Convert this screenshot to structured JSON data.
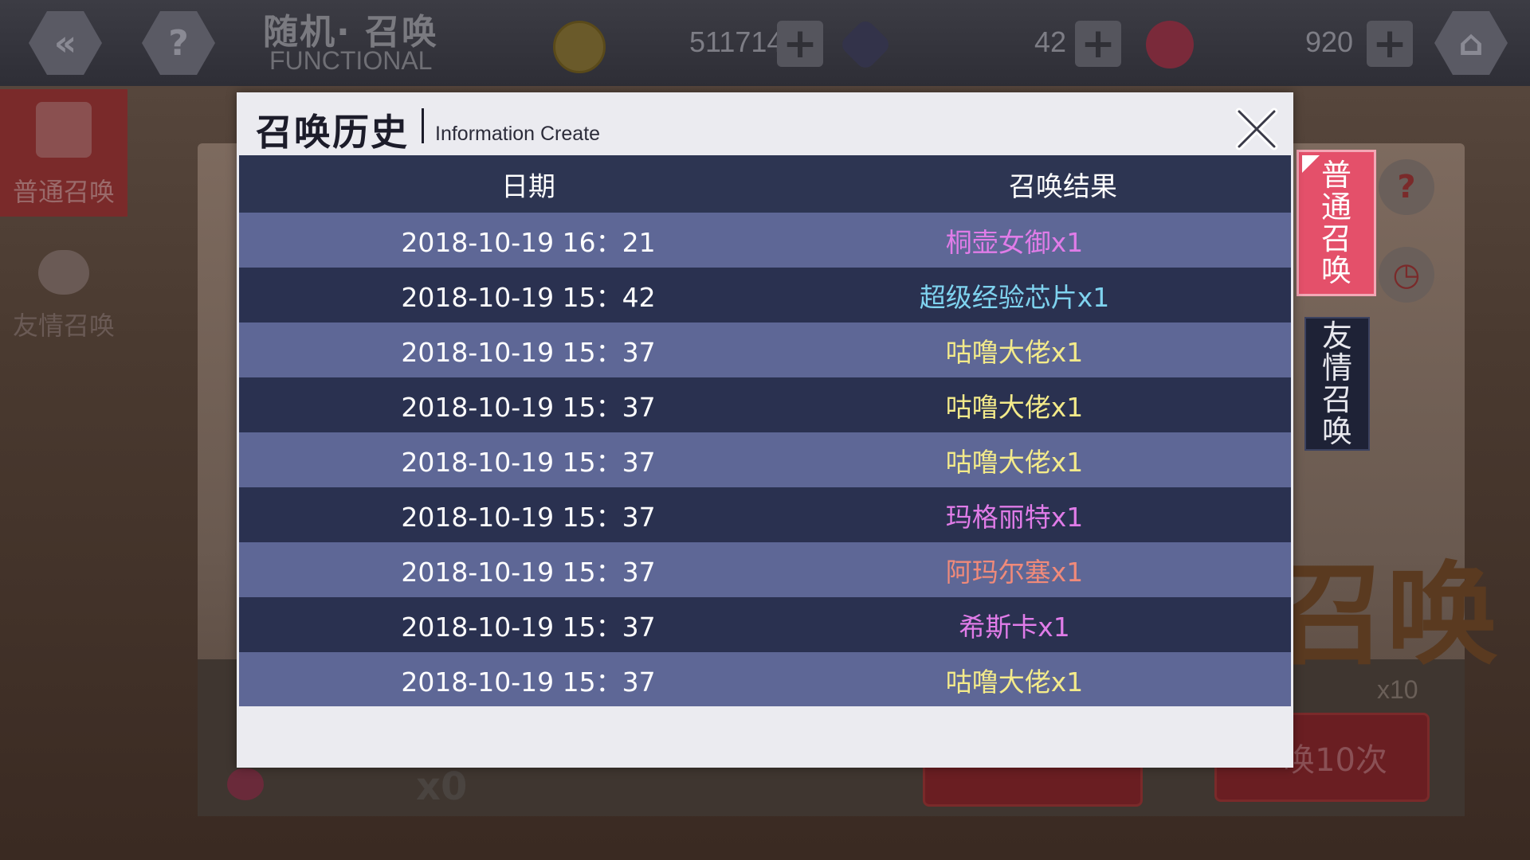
{
  "topbar": {
    "title": "随机· 召唤",
    "subtitle": "FUNCTIONAL",
    "coins": "511714",
    "gems": "42",
    "hearts": "920"
  },
  "left_tabs": {
    "normal": "普通召唤",
    "friend": "友情召唤"
  },
  "side_tabs": {
    "normal": [
      "普",
      "通",
      "召",
      "唤"
    ],
    "friend": [
      "友",
      "情",
      "召",
      "唤"
    ]
  },
  "background": {
    "x10": "x10",
    "x0": "x0",
    "summon10_label": "唤10次",
    "big_text": "召唤"
  },
  "modal": {
    "title": "召唤历史",
    "subtitle": "Information Create",
    "headers": {
      "date": "日期",
      "result": "召唤结果"
    },
    "rows": [
      {
        "date": "2018-10-19 16：21",
        "result": "桐壶女御x1",
        "color": "#e07ce8"
      },
      {
        "date": "2018-10-19 15：42",
        "result": "超级经验芯片x1",
        "color": "#7fd3ef"
      },
      {
        "date": "2018-10-19 15：37",
        "result": "咕噜大佬x1",
        "color": "#f3ea8a"
      },
      {
        "date": "2018-10-19 15：37",
        "result": "咕噜大佬x1",
        "color": "#f3ea8a"
      },
      {
        "date": "2018-10-19 15：37",
        "result": "咕噜大佬x1",
        "color": "#f3ea8a"
      },
      {
        "date": "2018-10-19 15：37",
        "result": "玛格丽特x1",
        "color": "#e07ce8"
      },
      {
        "date": "2018-10-19 15：37",
        "result": "阿玛尔塞x1",
        "color": "#f08a7a"
      },
      {
        "date": "2018-10-19 15：37",
        "result": "希斯卡x1",
        "color": "#e07ce8"
      },
      {
        "date": "2018-10-19 15：37",
        "result": "咕噜大佬x1",
        "color": "#f3ea8a"
      }
    ]
  },
  "colors": {
    "header_bg": "#2d3552",
    "row_odd": "#5e6796",
    "row_even": "#2a3150",
    "tab_active": "#e4506a"
  }
}
